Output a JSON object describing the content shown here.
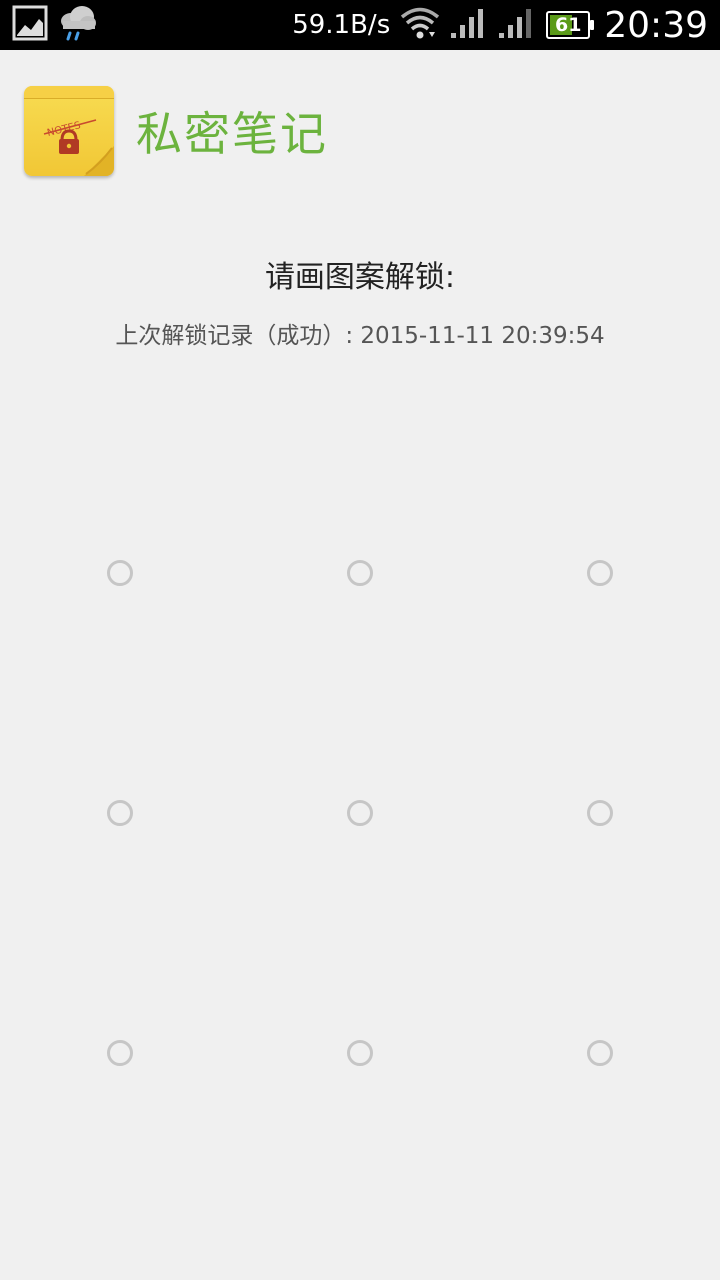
{
  "status_bar": {
    "notification_icons": [
      "gallery-icon",
      "rain-cloud-icon"
    ],
    "network_speed": "59.1B/s",
    "battery_level": "61",
    "battery_fraction": 0.61,
    "time": "20:39",
    "indicator_icons": [
      "wifi-icon",
      "signal-icon",
      "signal-icon",
      "battery-icon"
    ]
  },
  "header": {
    "app_icon": "notes-lock-icon",
    "app_icon_text": "NOTES",
    "title": "私密笔记"
  },
  "lock": {
    "prompt": "请画图案解锁:",
    "last_unlock": "上次解锁记录（成功）: 2015-11-11 20:39:54"
  },
  "pattern": {
    "rows": 3,
    "cols": 3,
    "dot_color": "#c6c6c6"
  },
  "colors": {
    "accent": "#6cb33e",
    "background": "#f0f0f0",
    "status_bar": "#000000",
    "battery_fill": "#5a9a18"
  }
}
